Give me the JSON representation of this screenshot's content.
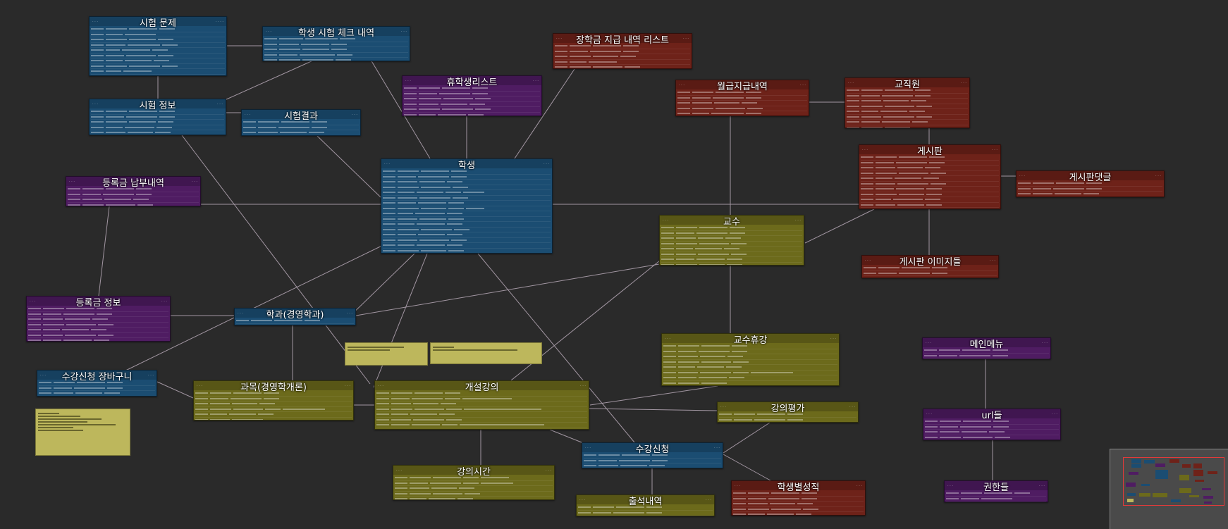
{
  "colors": {
    "background": "#2a2a2a",
    "blue": "#1b4d72",
    "red": "#6e2219",
    "purple": "#4f1c62",
    "olive": "#6c6a1b",
    "note": "#bdb75c",
    "link": "#b7a9b7",
    "minimap_frame": "#e23a3a"
  },
  "tables": [
    {
      "id": "exam-question",
      "title": "시험 문제",
      "color": "blue"
    },
    {
      "id": "student-exam-check",
      "title": "학생 시험 체크 내역",
      "color": "blue"
    },
    {
      "id": "scholarship-payment",
      "title": "장학금 지급 내역 리스트",
      "color": "red"
    },
    {
      "id": "leave-student-list",
      "title": "휴학생리스트",
      "color": "purple"
    },
    {
      "id": "salary-payment",
      "title": "월급지급내역",
      "color": "red"
    },
    {
      "id": "staff",
      "title": "교직원",
      "color": "red"
    },
    {
      "id": "exam-info",
      "title": "시험 정보",
      "color": "blue"
    },
    {
      "id": "exam-result",
      "title": "시험결과",
      "color": "blue"
    },
    {
      "id": "board",
      "title": "게시판",
      "color": "red"
    },
    {
      "id": "board-comment",
      "title": "게시판댓글",
      "color": "red"
    },
    {
      "id": "student",
      "title": "학생",
      "color": "blue"
    },
    {
      "id": "tuition-payment",
      "title": "등록금 납부내역",
      "color": "purple"
    },
    {
      "id": "professor",
      "title": "교수",
      "color": "olive"
    },
    {
      "id": "board-images",
      "title": "게시판 이미지들",
      "color": "red"
    },
    {
      "id": "tuition-info",
      "title": "등록금 정보",
      "color": "purple"
    },
    {
      "id": "department",
      "title": "학과(경영학과)",
      "color": "blue"
    },
    {
      "id": "professor-leave",
      "title": "교수휴강",
      "color": "olive"
    },
    {
      "id": "main-menu",
      "title": "메인메뉴",
      "color": "purple"
    },
    {
      "id": "enroll-cart",
      "title": "수강신청 장바구니",
      "color": "blue"
    },
    {
      "id": "subject",
      "title": "과목(경영학개론)",
      "color": "olive"
    },
    {
      "id": "open-lecture",
      "title": "개설강의",
      "color": "olive"
    },
    {
      "id": "lecture-eval",
      "title": "강의평가",
      "color": "olive"
    },
    {
      "id": "urls",
      "title": "url들",
      "color": "purple"
    },
    {
      "id": "enrollment",
      "title": "수강신청",
      "color": "blue"
    },
    {
      "id": "lecture-time",
      "title": "강의시간",
      "color": "olive"
    },
    {
      "id": "grades",
      "title": "학생별성적",
      "color": "red"
    },
    {
      "id": "permissions",
      "title": "권한들",
      "color": "purple"
    },
    {
      "id": "attendance",
      "title": "출석내역",
      "color": "olive"
    }
  ]
}
